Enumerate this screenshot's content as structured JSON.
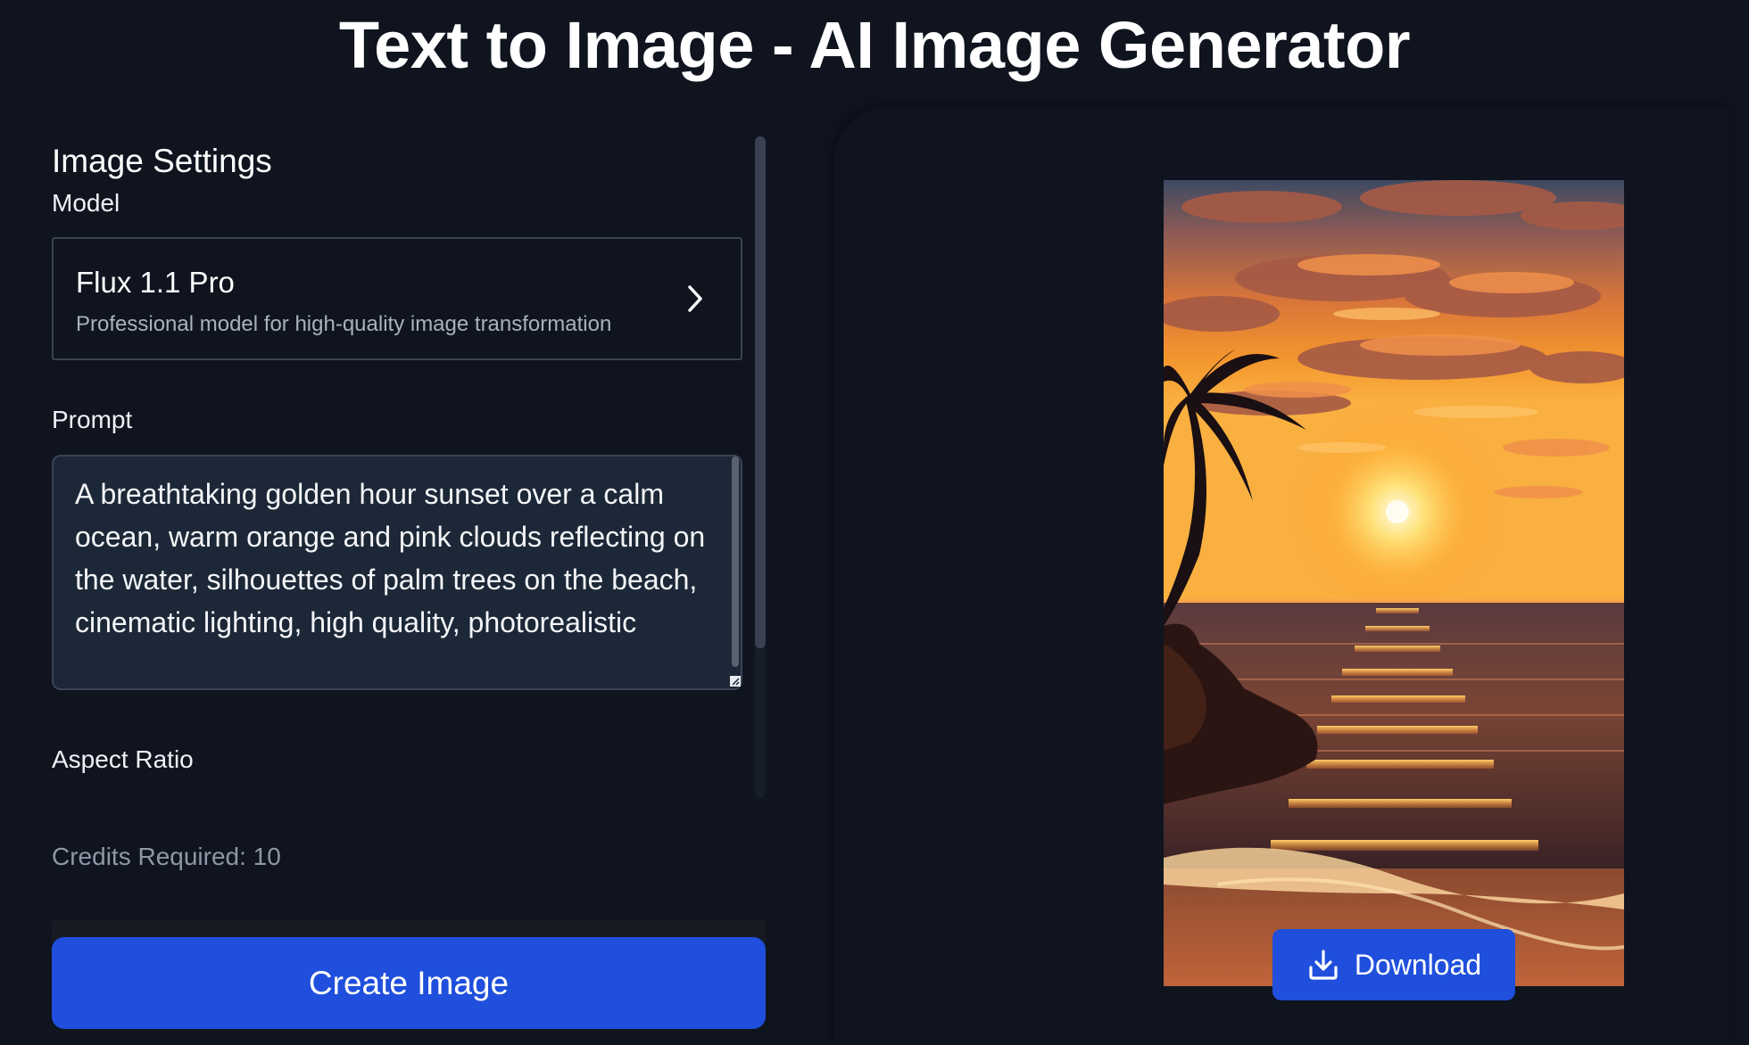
{
  "header": {
    "title": "Text to Image - AI Image Generator"
  },
  "settings": {
    "title": "Image Settings",
    "model_label": "Model",
    "model": {
      "name": "Flux 1.1 Pro",
      "description": "Professional model for high-quality image transformation",
      "icon": "chevron-right-icon"
    },
    "prompt_label": "Prompt",
    "prompt_value": "A breathtaking golden hour sunset over a calm ocean, warm orange and pink clouds reflecting on the water, silhouettes of palm trees on the beach, cinematic lighting, high quality, photorealistic",
    "aspect_ratio_label": "Aspect Ratio",
    "credits": "Credits Required: 10"
  },
  "actions": {
    "create_label": "Create Image"
  },
  "preview": {
    "download_label": "Download",
    "download_icon": "download-icon"
  },
  "colors": {
    "background": "#0f141f",
    "accent": "#1f4fdc",
    "input_bg": "#1c2837"
  }
}
